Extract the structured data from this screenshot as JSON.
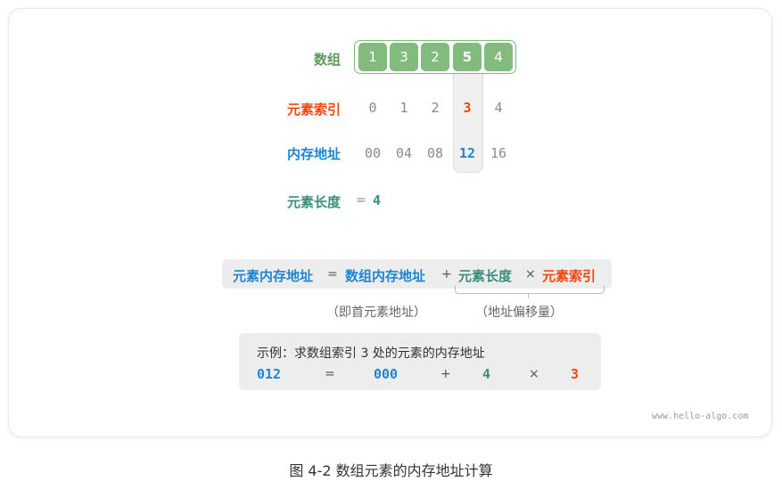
{
  "diagram": {
    "labels": {
      "array": "数组",
      "index": "元素索引",
      "address": "内存地址",
      "length": "元素长度"
    },
    "array_values": [
      "1",
      "3",
      "2",
      "5",
      "4"
    ],
    "indices": [
      "0",
      "1",
      "2",
      "3",
      "4"
    ],
    "addresses": [
      "00",
      "04",
      "08",
      "12",
      "16"
    ],
    "highlight_index": 3,
    "length_eq": "=",
    "length_value": "4",
    "colors": {
      "array_cell": "#83bb7e",
      "index_highlight": "#f2470f",
      "address_highlight": "#1e86d0",
      "length": "#3b8e7e"
    }
  },
  "formula": {
    "result": "元素内存地址",
    "eq": "=",
    "base": "数组内存地址",
    "plus": "+",
    "length": "元素长度",
    "times": "×",
    "index": "元素索引",
    "note_base": "（即首元素地址）",
    "note_offset": "（地址偏移量）"
  },
  "example": {
    "title": "示例：求数组索引 3 处的元素的内存地址",
    "result": "012",
    "eq": "=",
    "base": "000",
    "plus": "+",
    "length": "4",
    "times": "×",
    "index": "3"
  },
  "watermark": "www.hello-algo.com",
  "caption": "图 4-2   数组元素的内存地址计算"
}
